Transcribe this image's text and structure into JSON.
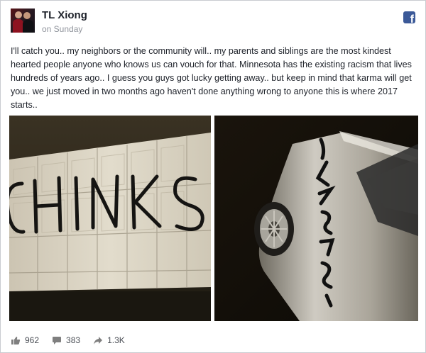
{
  "post": {
    "author": "TL Xiong",
    "timestamp": "on Sunday",
    "text": "I'll catch you.. my neighbors or the community will.. my parents and siblings are the most kindest hearted people anyone who knows us can vouch for that. Minnesota has the existing racism that lives hundreds of years ago.. I guess you guys got lucky getting away.. but keep in mind that karma will get you.. we just moved in two months ago haven't done anything wrong to anyone this is where 2017 starts..",
    "platform_icon": "facebook-icon"
  },
  "photos": [
    {
      "name": "garage-door-photo",
      "graffiti": "CHINKS"
    },
    {
      "name": "car-photo"
    }
  ],
  "stats": {
    "likes": "962",
    "comments": "383",
    "shares": "1.3K"
  },
  "colors": {
    "facebook_blue": "#3b5998",
    "text": "#1d2129",
    "muted": "#90949c"
  }
}
